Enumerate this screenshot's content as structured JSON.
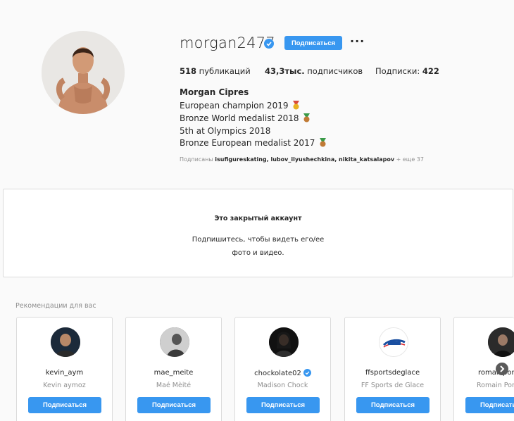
{
  "profile": {
    "username": "morgan2477",
    "follow_label": "Подписаться",
    "more_label": "···",
    "stats": {
      "posts_value": "518",
      "posts_label": "публикаций",
      "followers_value": "43,3тыс.",
      "followers_label": "подписчиков",
      "following_label": "Подписки:",
      "following_value": "422"
    },
    "full_name": "Morgan Cipres",
    "bio": [
      "European champion 2019",
      "Bronze World medalist 2018",
      "5th at Olympics 2018",
      "Bronze European medalist 2017"
    ],
    "followed_by_prefix": "Подписаны",
    "followed_by_names": "isufigureskating, lubov_ilyushechkina, nikita_katsalapov",
    "followed_by_more": "+ еще 37"
  },
  "private": {
    "title": "Это закрытый аккаунт",
    "desc_line1": "Подпишитесь, чтобы видеть его/ее",
    "desc_line2": "фото и видео."
  },
  "recommendations": {
    "title": "Рекомендации для вас",
    "cards": [
      {
        "username": "kevin_aym",
        "name": "Kevin aymoz",
        "button": "Подписаться"
      },
      {
        "username": "mae_meite",
        "name": "Maé Mèité",
        "button": "Подписаться"
      },
      {
        "username": "chockolate02",
        "name": "Madison Chock",
        "button": "Подписаться"
      },
      {
        "username": "ffsportsdeglace",
        "name": "FF Sports de Glace",
        "button": "Подписаться"
      },
      {
        "username": "romainpon",
        "name": "Romain Pon",
        "button": "Подписаться"
      }
    ]
  },
  "colors": {
    "accent": "#3897f0",
    "background": "#fafafa",
    "border": "#dbdbdb",
    "muted": "#8e8e8e"
  }
}
